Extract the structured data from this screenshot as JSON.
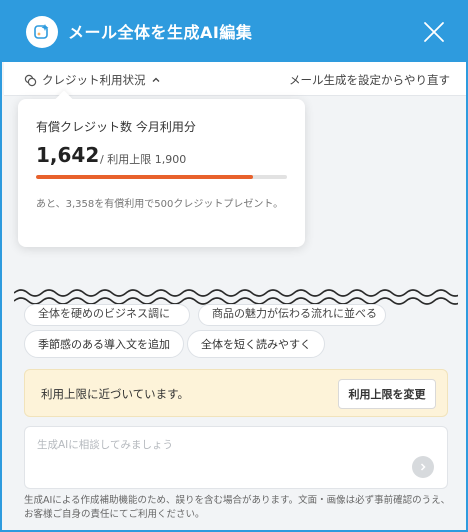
{
  "header": {
    "title": "メール全体を生成AI編集",
    "icon": "sparkle-edit-icon",
    "close_icon": "close-icon",
    "color": "#2e9bde"
  },
  "subbar": {
    "credit_label": "クレジット利用状況",
    "credit_icon": "coins-icon",
    "regen_link": "メール生成を設定からやり直す"
  },
  "credit_popover": {
    "heading": "有償クレジット数 今月利用分",
    "count": "1,642",
    "limit_text": "/ 利用上限 1,900",
    "usage_fraction": 0.864,
    "bar_color": "#e8612c",
    "note": "あと、3,358を有償利用で500クレジットプレゼント。"
  },
  "suggestions": {
    "cut_1": "全体を硬めのビジネス調に",
    "cut_2": "商品の魅力が伝わる流れに並べる",
    "chip_1": "季節感のある導入文を追加",
    "chip_2": "全体を短く読みやすく"
  },
  "warning": {
    "text": "利用上限に近づいています。",
    "button": "利用上限を変更",
    "bg_color": "#fdf3d9"
  },
  "chat": {
    "placeholder": "生成AIに相談してみましょう",
    "value": "",
    "send_icon": "chevron-right-icon"
  },
  "disclaimer": "生成AIによる作成補助機能のため、誤りを含む場合があります。文面・画像は必ず事前確認のうえ、お客様ご自身の責任にてご利用ください。"
}
